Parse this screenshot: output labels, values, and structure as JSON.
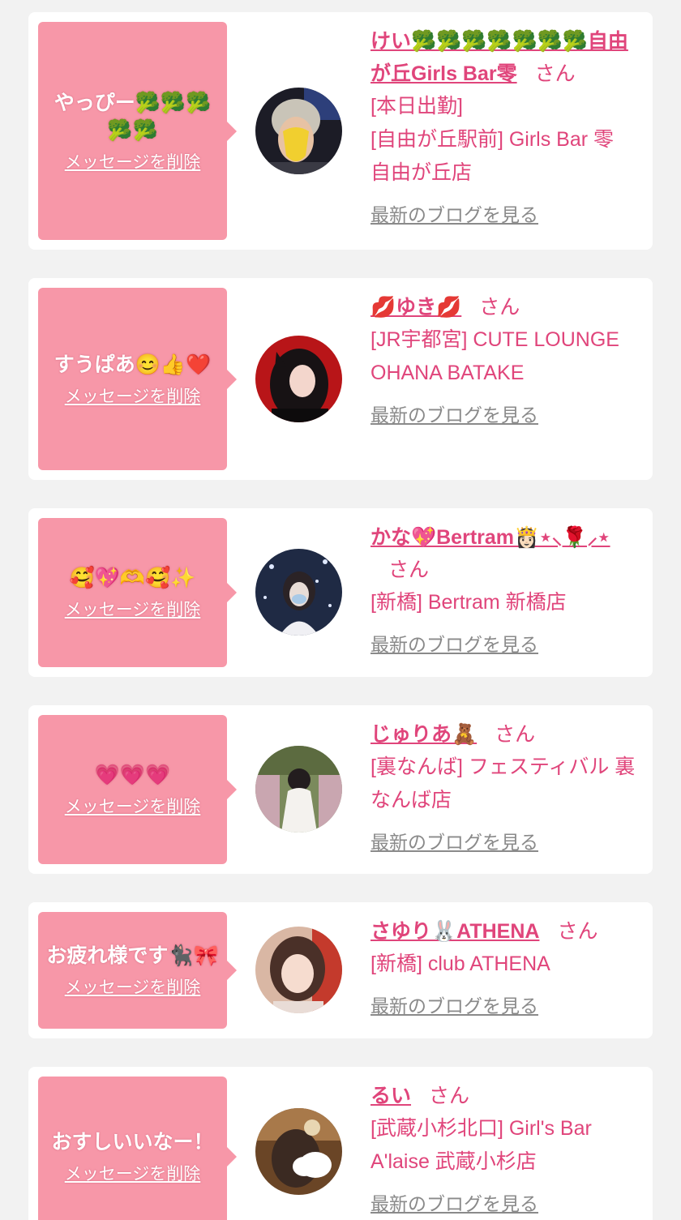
{
  "cards": [
    {
      "message": "やっぴー🥦🥦🥦🥦🥦",
      "delete_label": "メッセージを削除",
      "name": "けい🥦🥦🥦🥦🥦🥦🥦自由が丘Girls Bar零",
      "honorific": "さん",
      "status": "[本日出勤]",
      "shop": "[自由が丘駅前] Girls Bar 零　自由が丘店",
      "blog_label": "最新のブログを見る"
    },
    {
      "message": "すうぱあ😊👍❤️",
      "delete_label": "メッセージを削除",
      "name": "💋ゆき💋",
      "honorific": "さん",
      "status": "",
      "shop": "[JR宇都宮] CUTE LOUNGE OHANA BATAKE",
      "blog_label": "最新のブログを見る"
    },
    {
      "message": "🥰💖🫶🥰✨",
      "delete_label": "メッセージを削除",
      "name": "かな💖Bertram👸🏻⋆⸜🌹⸝⋆",
      "honorific": "さん",
      "status": "",
      "shop": "[新橋] Bertram 新橋店",
      "blog_label": "最新のブログを見る"
    },
    {
      "message": "💗💗💗",
      "delete_label": "メッセージを削除",
      "name": "じゅりあ🧸",
      "honorific": "さん",
      "status": "",
      "shop": "[裏なんば] フェスティバル 裏なんば店",
      "blog_label": "最新のブログを見る"
    },
    {
      "message": "お疲れ様です🐈‍⬛🎀",
      "delete_label": "メッセージを削除",
      "name": "さゆり🐰ATHENA",
      "honorific": "さん",
      "status": "",
      "shop": "[新橋] club ATHENA",
      "blog_label": "最新のブログを見る"
    },
    {
      "message": "おすしいいなー！",
      "delete_label": "メッセージを削除",
      "name": "るい",
      "honorific": "さん",
      "status": "",
      "shop": "[武蔵小杉北口] Girl's Bar A'laise 武蔵小杉店",
      "blog_label": "最新のブログを見る"
    }
  ],
  "colors": {
    "background": "#f2f2f2",
    "card": "#ffffff",
    "bubble": "#f797a8",
    "accent_text": "#e0457b",
    "blog_link": "#8a8a8a"
  }
}
